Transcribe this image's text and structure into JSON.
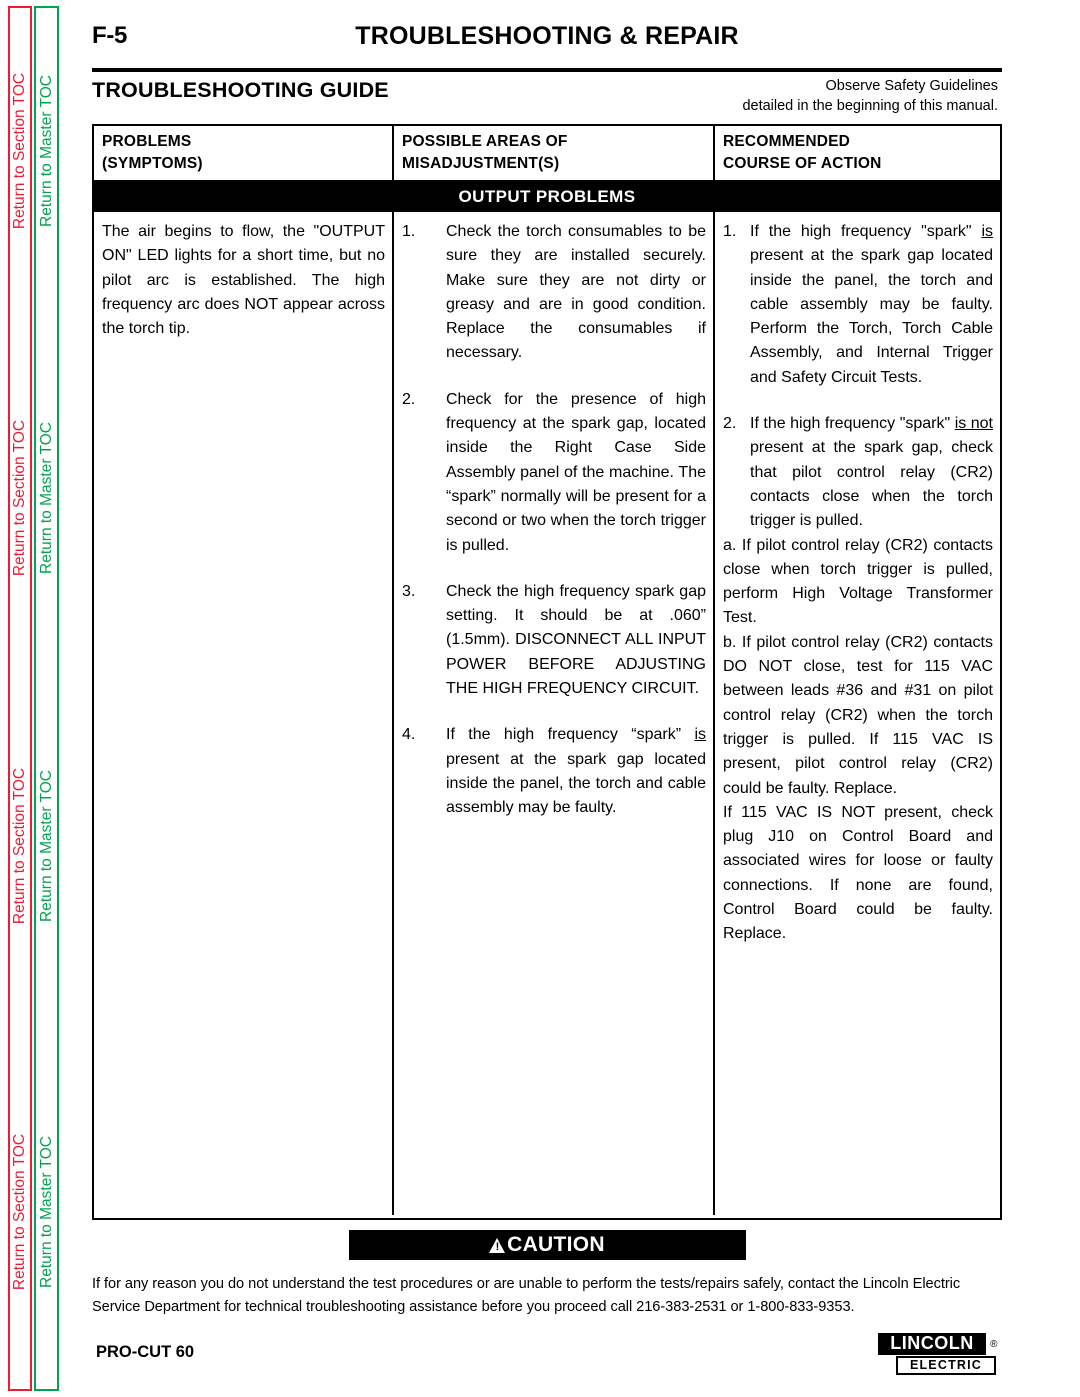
{
  "toc_rail": {
    "section_label": "Return to Section TOC",
    "master_label": "Return to Master TOC",
    "section_color": "#ED1C34",
    "master_color": "#00A550",
    "repeats": 4
  },
  "header": {
    "page_number": "F-5",
    "title": "TROUBLESHOOTING & REPAIR",
    "guide_title": "TROUBLESHOOTING GUIDE",
    "safety_note_line1": "Observe Safety Guidelines",
    "safety_note_line2": "detailed in the beginning of this manual."
  },
  "table": {
    "columns": [
      {
        "header_line1": "PROBLEMS",
        "header_line2": "(SYMPTOMS)"
      },
      {
        "header_line1": "POSSIBLE AREAS OF",
        "header_line2": "MISADJUSTMENT(S)"
      },
      {
        "header_line1": "RECOMMENDED",
        "header_line2": "COURSE OF ACTION"
      }
    ],
    "section_band": "OUTPUT PROBLEMS",
    "symptom": "The air begins to flow, the \"OUTPUT ON\" LED lights for a short time, but no pilot arc is established.  The high frequency arc does NOT appear across the torch tip.",
    "misadjustments": [
      {
        "marker": "1.",
        "text": "Check the torch consumables to be sure they are installed securely.   Make sure they  are not dirty or greasy and are in good condition.  Replace the consumables if necessary."
      },
      {
        "marker": "2.",
        "text": "Check for the presence of high frequency at the spark gap, located inside the Right Case Side Assembly panel of the machine. The “spark” normally will be present for a second or two when the torch trigger is pulled."
      },
      {
        "marker": "3.",
        "text": "Check the high frequency spark gap setting. It should be at .060” (1.5mm). DISCONNECT ALL INPUT POWER BEFORE ADJUSTING THE HIGH FREQUENCY CIRCUIT."
      },
      {
        "marker": "4.",
        "text_before": "If the high frequency “spark” ",
        "underlined": "is",
        "text_after": " present at the spark gap located inside the panel, the torch and cable assembly may be faulty."
      }
    ],
    "actions": [
      {
        "marker": "1.",
        "text_before": "If the high frequency \"spark\" ",
        "underlined": "is",
        "text_after": " present at the spark gap located inside the panel, the torch and cable assembly may be faulty. Perform the Torch, Torch Cable Assembly, and Internal Trigger and Safety Circuit Tests."
      },
      {
        "marker": "2.",
        "text_before": "If the high frequency \"spark\" ",
        "underlined": "is not",
        "text_after": " present at the spark gap, check that pilot control relay (CR2) contacts close when the torch trigger is pulled.",
        "sub_items": [
          "a.  If pilot control relay (CR2) contacts close when torch trigger is pulled, perform  High  Voltage Transformer Test.",
          "b.  If pilot control relay (CR2) contacts DO NOT close, test for 115 VAC between leads #36 and #31 on pilot control relay (CR2) when the torch trigger is pulled.  If 115 VAC IS present, pilot control relay (CR2) could be faulty.  Replace.",
          "If 115 VAC IS NOT present, check plug J10 on Control Board and associated wires for loose or faulty connections.  If none are found, Control Board could be faulty.  Replace."
        ]
      }
    ]
  },
  "caution": {
    "label": "CAUTION",
    "icon": "warning-triangle-icon",
    "body": "If for any reason you do not understand the test procedures or are unable to perform the tests/repairs safely, contact the Lincoln Electric Service Department for technical troubleshooting assistance before you proceed call 216-383-2531 or 1-800-833-9353."
  },
  "footer": {
    "model": "PRO-CUT 60",
    "brand_top": "LINCOLN",
    "brand_reg": "®",
    "brand_bottom": "ELECTRIC"
  }
}
